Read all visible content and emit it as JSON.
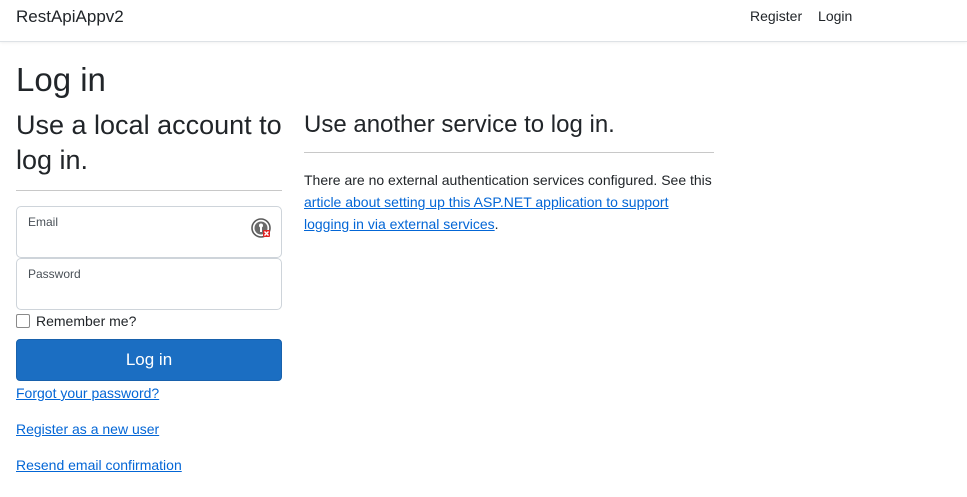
{
  "navbar": {
    "brand": "RestApiAppv2",
    "register": "Register",
    "login": "Login"
  },
  "page": {
    "title": "Log in"
  },
  "local": {
    "heading": "Use a local account to log in.",
    "email_label": "Email",
    "email_value": "",
    "password_label": "Password",
    "password_value": "",
    "remember_label": "Remember me?",
    "remember_checked": false,
    "login_button": "Log in",
    "forgot_link": "Forgot your password?",
    "register_link": "Register as a new user",
    "resend_link": "Resend email confirmation",
    "password_manager_icon": "password-manager-icon"
  },
  "external": {
    "heading": "Use another service to log in.",
    "text_before": "There are no external authentication services configured. See this ",
    "link_text": "article about setting up this ASP.NET application to support logging in via external services",
    "text_after": "."
  },
  "colors": {
    "primary_button": "#1b6ec2",
    "link": "#0366d6",
    "text": "#212529",
    "divider": "#c8c8c8"
  }
}
